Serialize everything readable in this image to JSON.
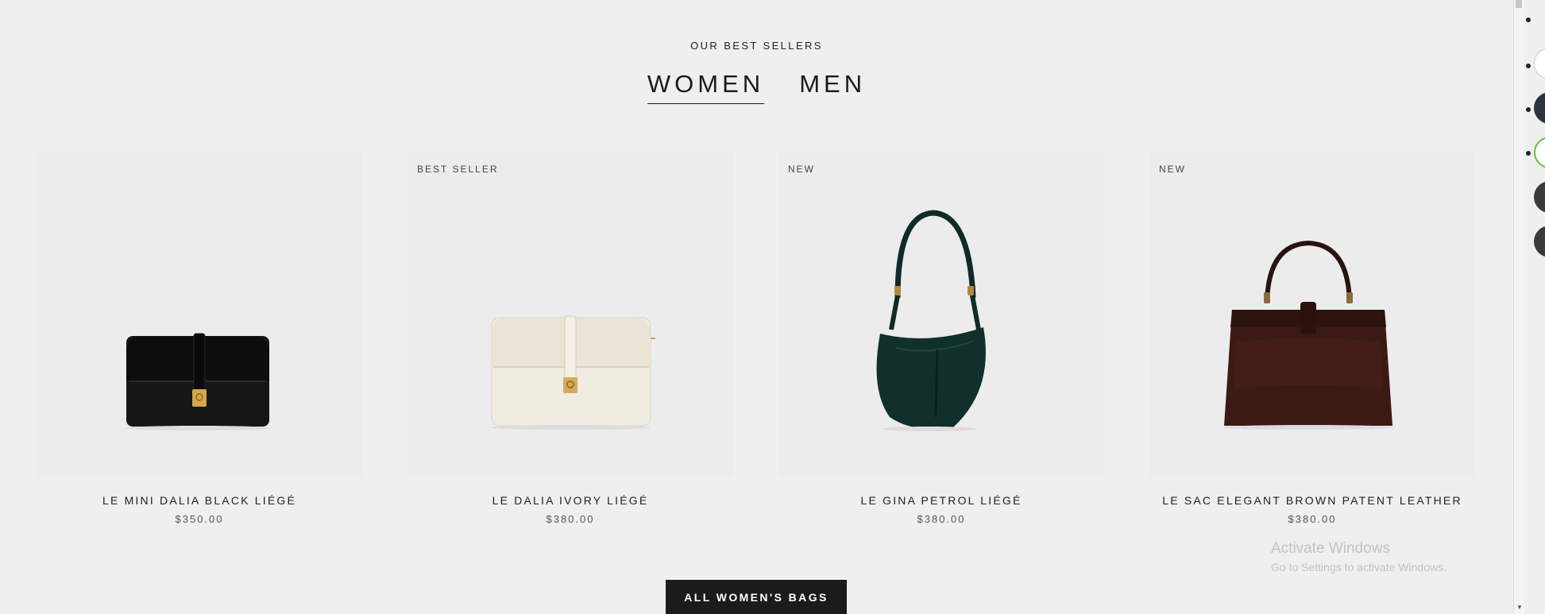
{
  "section": {
    "eyebrow": "OUR BEST SELLERS",
    "tabs": [
      {
        "label": "WOMEN",
        "active": true
      },
      {
        "label": "MEN",
        "active": false
      }
    ]
  },
  "products": [
    {
      "badge": "",
      "name": "LE MINI DALIA BLACK LIÉGÉ",
      "price": "$350.00",
      "image": "black-clutch-bag",
      "color": "#141414"
    },
    {
      "badge": "BEST SELLER",
      "name": "LE DALIA IVORY LIÉGÉ",
      "price": "$380.00",
      "image": "ivory-shoulder-bag",
      "color": "#ece6da"
    },
    {
      "badge": "NEW",
      "name": "LE GINA PETROL LIÉGÉ",
      "price": "$380.00",
      "image": "petrol-hobo-bag",
      "color": "#0f2e2a"
    },
    {
      "badge": "NEW",
      "name": "LE SAC ELEGANT BROWN PATENT LEATHER",
      "price": "$380.00",
      "image": "brown-top-handle-bag",
      "color": "#3a1a12"
    }
  ],
  "cta": {
    "label": "ALL WOMEN'S BAGS"
  },
  "watermark": {
    "title": "Activate Windows",
    "subtitle": "Go to Settings to activate Windows."
  },
  "colors": {
    "background": "#efefef",
    "button": "#1b1b1b",
    "text": "#1b1b1b"
  }
}
